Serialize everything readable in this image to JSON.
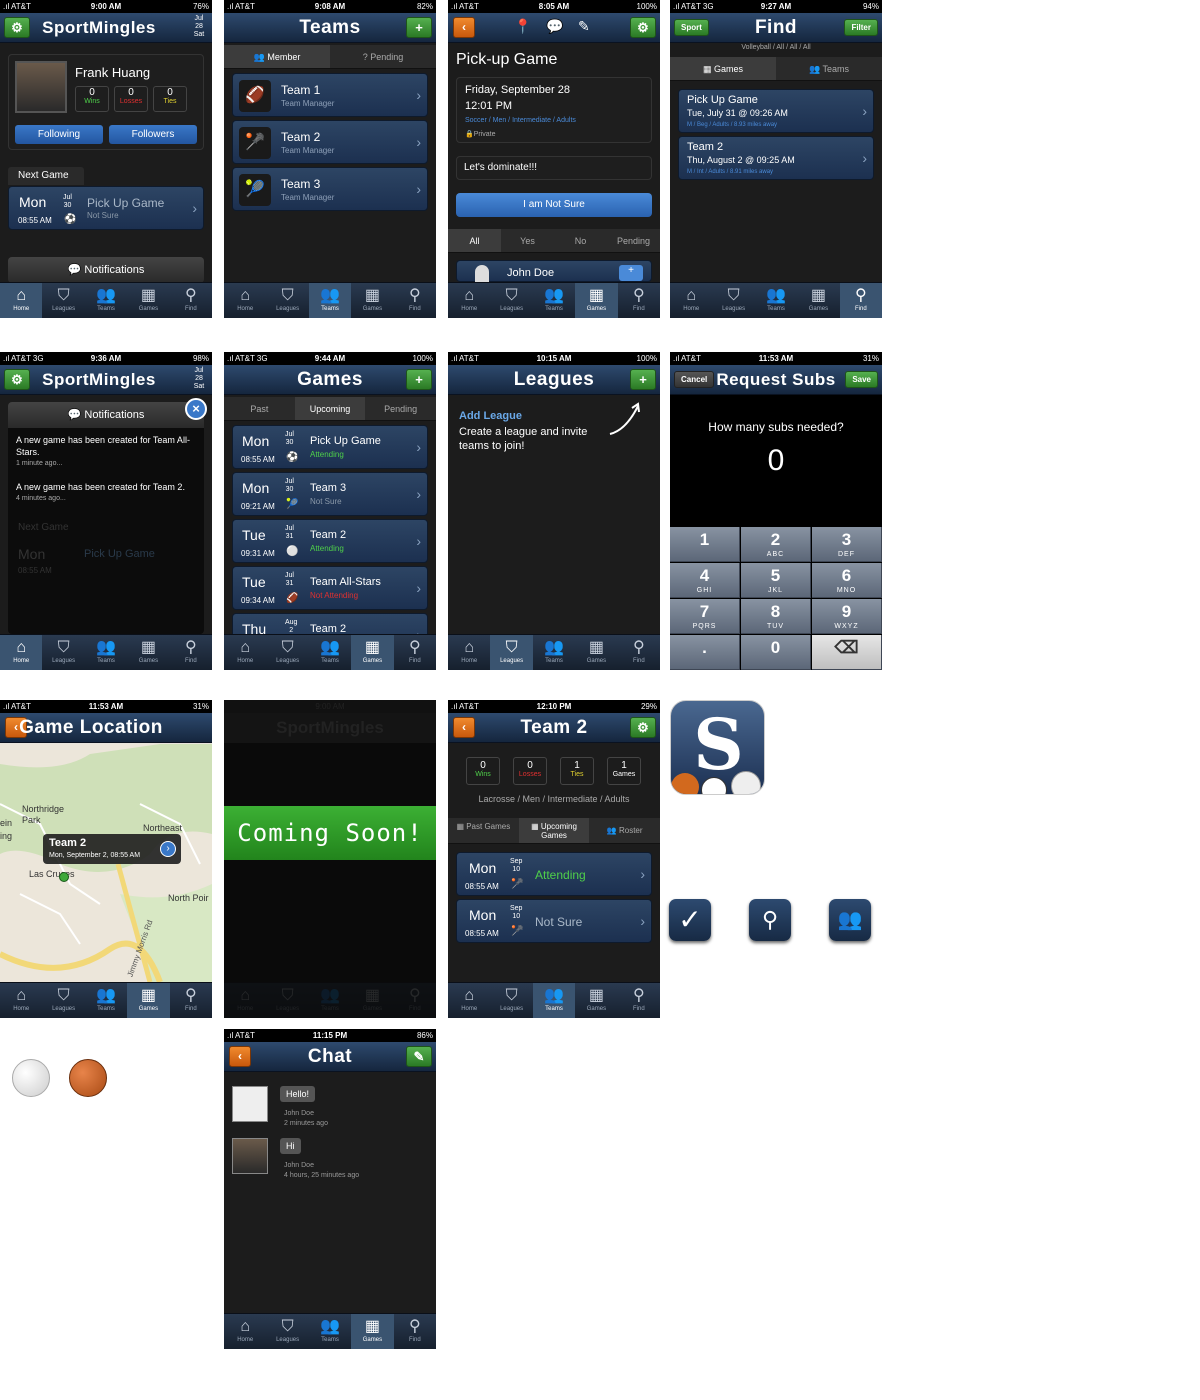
{
  "tabs": [
    "Home",
    "Leagues",
    "Teams",
    "Games",
    "Find"
  ],
  "p1": {
    "status": {
      "carrier": ".ıl AT&T",
      "time": "9:00 AM",
      "battery": "76%"
    },
    "title": "SportMingles",
    "date": {
      "month": "Jul",
      "day": "28",
      "dow": "Sat"
    },
    "profile": {
      "name": "Frank Huang",
      "wins": "0",
      "wins_label": "Wins",
      "losses": "0",
      "losses_label": "Losses",
      "ties": "0",
      "ties_label": "Ties",
      "following": "Following",
      "followers": "Followers"
    },
    "next_game_label": "Next Game",
    "next": {
      "dow": "Mon",
      "month": "Jul",
      "day": "30",
      "time": "08:55 AM",
      "title": "Pick Up Game",
      "status": "Not Sure"
    },
    "notifications": "Notifications"
  },
  "p2": {
    "status": {
      "carrier": ".ıl AT&T",
      "time": "9:08 AM",
      "battery": "82%"
    },
    "title": "Teams",
    "seg": [
      "Member",
      "Pending"
    ],
    "teams": [
      {
        "name": "Team 1",
        "role": "Team Manager"
      },
      {
        "name": "Team 2",
        "role": "Team Manager"
      },
      {
        "name": "Team 3",
        "role": "Team Manager"
      }
    ]
  },
  "p3": {
    "status": {
      "carrier": ".ıl AT&T",
      "time": "8:05 AM",
      "battery": "100%"
    },
    "game_title": "Pick-up Game",
    "date": "Friday, September 28",
    "time": "12:01 PM",
    "tags": "Soccer / Men / Intermediate / Adults",
    "privacy": "Private",
    "message": "Let's dominate!!!",
    "rsvp": "I am Not Sure",
    "filters": [
      "All",
      "Yes",
      "No",
      "Pending"
    ],
    "person": "John Doe"
  },
  "p4": {
    "status": {
      "carrier": ".ıl AT&T 3G",
      "time": "9:27 AM",
      "battery": "94%"
    },
    "title": "Find",
    "left_btn": "Sport",
    "right_btn": "Filter",
    "crumb": "Volleyball / All / All / All",
    "seg": [
      "Games",
      "Teams"
    ],
    "results": [
      {
        "title": "Pick Up Game",
        "when": "Tue, July 31 @ 09:26 AM",
        "meta": "M / Beg / Adults / 8.93 miles away"
      },
      {
        "title": "Team 2",
        "when": "Thu, August 2 @ 09:25 AM",
        "meta": "M / Int / Adults / 8.91 miles away"
      }
    ]
  },
  "p5": {
    "status": {
      "carrier": ".ıl AT&T 3G",
      "time": "9:36 AM",
      "battery": "98%"
    },
    "title": "SportMingles",
    "date": {
      "month": "Jul",
      "day": "28",
      "dow": "Sat"
    },
    "panel_title": "Notifications",
    "items": [
      {
        "text": "A new game has been created for Team All-Stars.",
        "ago": "1 minute ago..."
      },
      {
        "text": "A new game has been created for Team 2.",
        "ago": "4 minutes ago..."
      }
    ],
    "ghost_next": "Next Game",
    "ghost_dow": "Mon",
    "ghost_time": "08:55 AM",
    "ghost_title": "Pick Up Game"
  },
  "p6": {
    "status": {
      "carrier": ".ıl AT&T 3G",
      "time": "9:44 AM",
      "battery": "100%"
    },
    "title": "Games",
    "seg": [
      "Past",
      "Upcoming",
      "Pending"
    ],
    "games": [
      {
        "dow": "Mon",
        "month": "Jul",
        "day": "30",
        "time": "08:55 AM",
        "title": "Pick Up Game",
        "status": "Attending",
        "cls": "green"
      },
      {
        "dow": "Mon",
        "month": "Jul",
        "day": "30",
        "time": "09:21 AM",
        "title": "Team 3",
        "status": "Not Sure",
        "cls": ""
      },
      {
        "dow": "Tue",
        "month": "Jul",
        "day": "31",
        "time": "09:31 AM",
        "title": "Team 2",
        "status": "Attending",
        "cls": "green"
      },
      {
        "dow": "Tue",
        "month": "Jul",
        "day": "31",
        "time": "09:34 AM",
        "title": "Team All-Stars",
        "status": "Not Attending",
        "cls": "red"
      },
      {
        "dow": "Thu",
        "month": "Aug",
        "day": "2",
        "time": "",
        "title": "Team 2",
        "status": "",
        "cls": ""
      }
    ]
  },
  "p7": {
    "status": {
      "carrier": ".ıl AT&T",
      "time": "10:15 AM",
      "battery": "100%"
    },
    "title": "Leagues",
    "add_title": "Add League",
    "add_text": "Create a league and invite teams to join!"
  },
  "p8": {
    "status": {
      "carrier": ".ıl AT&T",
      "time": "11:53 AM",
      "battery": "31%"
    },
    "title": "Request Subs",
    "cancel": "Cancel",
    "save": "Save",
    "question": "How many subs needed?",
    "value": "0",
    "keys": [
      {
        "n": "1",
        "l": ""
      },
      {
        "n": "2",
        "l": "ABC"
      },
      {
        "n": "3",
        "l": "DEF"
      },
      {
        "n": "4",
        "l": "GHI"
      },
      {
        "n": "5",
        "l": "JKL"
      },
      {
        "n": "6",
        "l": "MNO"
      },
      {
        "n": "7",
        "l": "PQRS"
      },
      {
        "n": "8",
        "l": "TUV"
      },
      {
        "n": "9",
        "l": "WXYZ"
      },
      {
        "n": ".",
        "l": ""
      },
      {
        "n": "0",
        "l": ""
      },
      {
        "n": "⌫",
        "l": ""
      }
    ]
  },
  "p9": {
    "status": {
      "carrier": ".ıl AT&T",
      "time": "11:53 AM",
      "battery": "31%"
    },
    "title": "Game Location",
    "places": [
      "Northridge Park",
      "Northeast",
      "Las Cruces",
      "North Poir",
      "Jimmy Morris Rd",
      "ein",
      "ing"
    ],
    "pin_title": "Team 2",
    "pin_sub": "Mon, September 2, 08:55 AM"
  },
  "p10": {
    "status_time": "9:00 AM",
    "title": "SportMingles",
    "banner": "Coming Soon!"
  },
  "p11": {
    "status": {
      "carrier": ".ıl AT&T",
      "time": "12:10 PM",
      "battery": "29%"
    },
    "title": "Team 2",
    "stats": [
      {
        "v": "0",
        "l": "Wins",
        "cls": "green"
      },
      {
        "v": "0",
        "l": "Losses",
        "cls": "red"
      },
      {
        "v": "1",
        "l": "Ties",
        "cls": "yel"
      },
      {
        "v": "1",
        "l": "Games",
        "cls": ""
      }
    ],
    "tags": "Lacrosse / Men / Intermediate / Adults",
    "seg": [
      "Past Games",
      "Upcoming Games",
      "Roster"
    ],
    "games": [
      {
        "dow": "Mon",
        "month": "Sep",
        "day": "10",
        "time": "08:55 AM",
        "status": "Attending",
        "cls": "green"
      },
      {
        "dow": "Mon",
        "month": "Sep",
        "day": "10",
        "time": "08:55 AM",
        "status": "Not Sure",
        "cls": ""
      }
    ]
  },
  "p12": {
    "status": {
      "carrier": ".ıl AT&T",
      "time": "11:15 PM",
      "battery": "86%"
    },
    "title": "Chat",
    "msgs": [
      {
        "text": "Hello!",
        "who": "John Doe",
        "ago": "2 minutes ago"
      },
      {
        "text": "Hi",
        "who": "John Doe",
        "ago": "4 hours, 25 minutes ago"
      }
    ]
  },
  "colors": {
    "accent": "#2b4a70",
    "green": "#3ea83a",
    "orange": "#e8731c"
  }
}
